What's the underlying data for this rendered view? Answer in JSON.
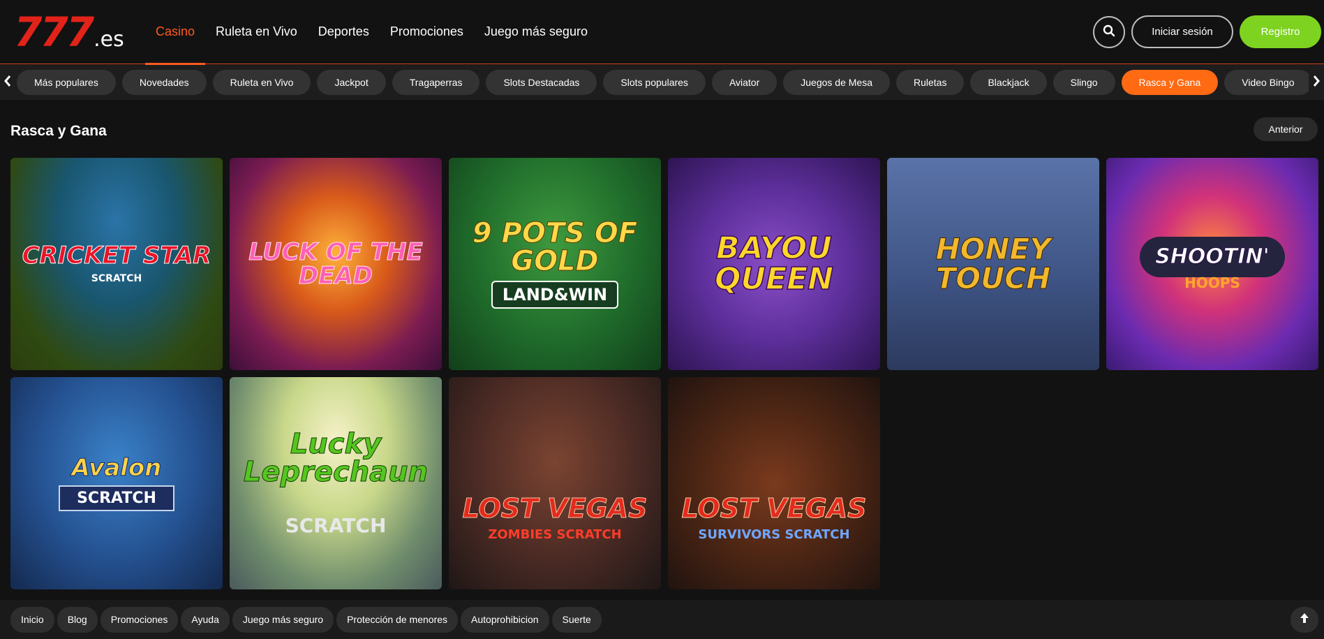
{
  "header": {
    "logo_number": "777",
    "logo_tld": ".es",
    "nav": [
      {
        "label": "Casino",
        "active": true
      },
      {
        "label": "Ruleta en Vivo"
      },
      {
        "label": "Deportes"
      },
      {
        "label": "Promociones"
      },
      {
        "label": "Juego más seguro"
      }
    ],
    "search_icon": "search-icon",
    "login_label": "Iniciar sesión",
    "register_label": "Registro"
  },
  "categories": {
    "items": [
      "Más populares",
      "Novedades",
      "Ruleta en Vivo",
      "Jackpot",
      "Tragaperras",
      "Slots Destacadas",
      "Slots populares",
      "Aviator",
      "Juegos de Mesa",
      "Ruletas",
      "Blackjack",
      "Slingo",
      "Rasca y Gana",
      "Video Bingo"
    ],
    "active": "Rasca y Gana",
    "left_icon": "chevron-left-icon",
    "right_icon": "chevron-right-icon"
  },
  "section": {
    "title": "Rasca y Gana",
    "prev_label": "Anterior"
  },
  "games": [
    {
      "title": "Cricket Star",
      "sub": "Scratch"
    },
    {
      "title": "Luck of the Dead",
      "sub": ""
    },
    {
      "title": "9 Pots of Gold",
      "sub": "Land&Win"
    },
    {
      "title": "Bayou Queen",
      "sub": ""
    },
    {
      "title": "Honey Touch",
      "sub": ""
    },
    {
      "title": "Shootin'",
      "sub": "Hoops"
    },
    {
      "title": "Avalon",
      "sub": "Scratch"
    },
    {
      "title": "Lucky Leprechaun",
      "sub": "Scratch"
    },
    {
      "title": "Lost Vegas",
      "sub": "Zombies Scratch"
    },
    {
      "title": "Lost Vegas",
      "sub": "Survivors Scratch"
    }
  ],
  "footer": {
    "links": [
      "Inicio",
      "Blog",
      "Promociones",
      "Ayuda",
      "Juego más seguro",
      "Protección de menores",
      "Autoprohibicion",
      "Suerte"
    ],
    "to_top_icon": "arrow-up-icon"
  },
  "colors": {
    "accent": "#ff6a13",
    "brand_red": "#e2231a",
    "register_green": "#7ed321",
    "background": "#121212"
  }
}
